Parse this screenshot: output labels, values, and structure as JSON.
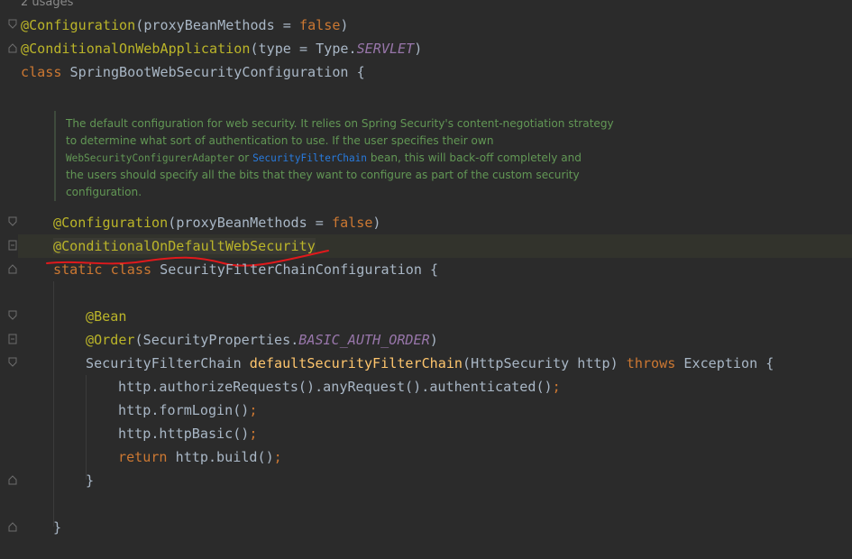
{
  "editor": {
    "usages_hint": "2 usages",
    "code": {
      "l1": {
        "annotation": "@Configuration",
        "args": "(proxyBeanMethods = ",
        "value": "false",
        "close": ")"
      },
      "l2": {
        "annotation": "@ConditionalOnWebApplication",
        "args": "(type = Type.",
        "constant": "SERVLET",
        "close": ")"
      },
      "l3": {
        "keyword": "class",
        "rest": " SpringBootWebSecurityConfiguration {"
      },
      "doc": {
        "d1": "The default configuration for web security. It relies on Spring Security's content-negotiation strategy",
        "d2": "to determine what sort of authentication to use. If the user specifies their own",
        "d3_code": "WebSecurityConfigurerAdapter",
        "d3_mid": " or ",
        "d3_link": "SecurityFilterChain",
        "d3_end": " bean, this will back-off completely and",
        "d4": "the users should specify all the bits that they want to configure as part of the custom security",
        "d5": "configuration."
      },
      "l4": {
        "annotation": "@Configuration",
        "args": "(proxyBeanMethods = ",
        "value": "false",
        "close": ")"
      },
      "l5": {
        "annotation": "@ConditionalOnDefaultWebSecurity"
      },
      "l6": {
        "kw1": "static",
        "kw2": "class",
        "rest": " SecurityFilterChainConfiguration {"
      },
      "l7": {
        "annotation": "@Bean"
      },
      "l8": {
        "annotation": "@Order",
        "open": "(SecurityProperties.",
        "constant": "BASIC_AUTH_ORDER",
        "close": ")"
      },
      "l9": {
        "type": "SecurityFilterChain ",
        "method": "defaultSecurityFilterChain",
        "params": "(HttpSecurity http) ",
        "throws": "throws",
        "exc": " Exception {"
      },
      "l10": {
        "code": "http.authorizeRequests().anyRequest().authenticated()",
        "semi": ";"
      },
      "l11": {
        "code": "http.formLogin()",
        "semi": ";"
      },
      "l12": {
        "code": "http.httpBasic()",
        "semi": ";"
      },
      "l13": {
        "keyword": "return",
        "code": " http.build()",
        "semi": ";"
      },
      "l14": {
        "brace": "}"
      },
      "l15": {
        "brace": "}"
      }
    },
    "colors": {
      "background": "#2b2b2b",
      "annotation": "#bbb529",
      "keyword": "#cc7832",
      "constant": "#9876aa",
      "method": "#ffc66d",
      "plain": "#a9b7c6",
      "doc_comment": "#629755",
      "doc_link": "#287bde",
      "red_underline": "#e0191c"
    }
  }
}
